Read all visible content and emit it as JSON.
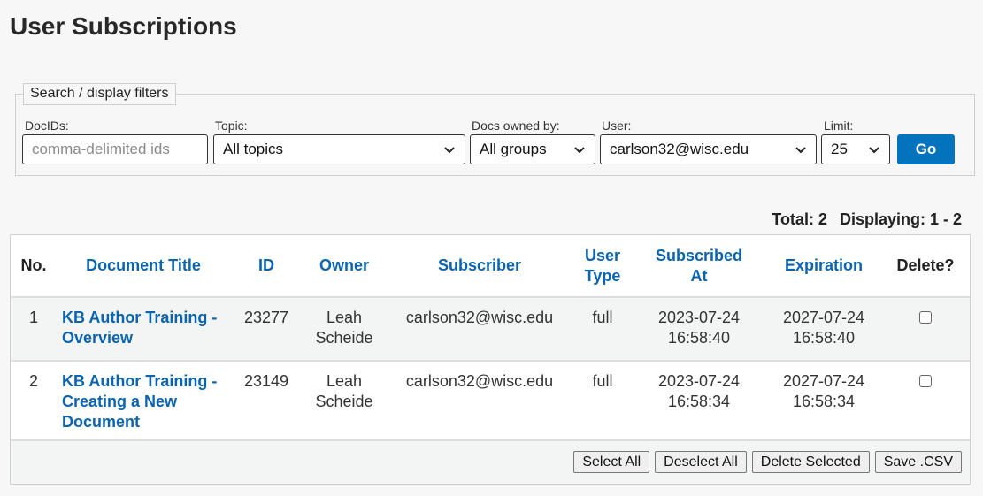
{
  "page": {
    "title": "User Subscriptions"
  },
  "filters": {
    "legend": "Search / display filters",
    "docids": {
      "label": "DocIDs:",
      "value": "",
      "placeholder": "comma-delimited ids"
    },
    "topic": {
      "label": "Topic:",
      "value": "All topics"
    },
    "owned_by": {
      "label": "Docs owned by:",
      "value": "All groups"
    },
    "user": {
      "label": "User:",
      "value": "carlson32@wisc.edu"
    },
    "limit": {
      "label": "Limit:",
      "value": "25"
    },
    "go_label": "Go"
  },
  "summary": {
    "total": "Total: 2",
    "displaying": "Displaying: 1 - 2"
  },
  "table": {
    "headers": {
      "no": "No.",
      "title": "Document Title",
      "id": "ID",
      "owner": "Owner",
      "subscriber": "Subscriber",
      "user_type_1": "User",
      "user_type_2": "Type",
      "subscribed_1": "Subscribed",
      "subscribed_2": "At",
      "expiration": "Expiration",
      "delete": "Delete?"
    },
    "rows": [
      {
        "no": "1",
        "title": "KB Author Training - Overview",
        "id": "23277",
        "owner_first": "Leah",
        "owner_last": "Scheide",
        "subscriber": "carlson32@wisc.edu",
        "user_type": "full",
        "subscribed_date": "2023-07-24",
        "subscribed_time": "16:58:40",
        "expiration_date": "2027-07-24",
        "expiration_time": "16:58:40",
        "delete_checked": false
      },
      {
        "no": "2",
        "title": "KB Author Training - Creating a New Document",
        "id": "23149",
        "owner_first": "Leah",
        "owner_last": "Scheide",
        "subscriber": "carlson32@wisc.edu",
        "user_type": "full",
        "subscribed_date": "2023-07-24",
        "subscribed_time": "16:58:34",
        "expiration_date": "2027-07-24",
        "expiration_time": "16:58:34",
        "delete_checked": false
      }
    ]
  },
  "actions": {
    "select_all": "Select All",
    "deselect_all": "Deselect All",
    "delete_selected": "Delete Selected",
    "save_csv": "Save .CSV"
  },
  "colors": {
    "accent": "#0473bd",
    "link": "#0a64b0"
  }
}
